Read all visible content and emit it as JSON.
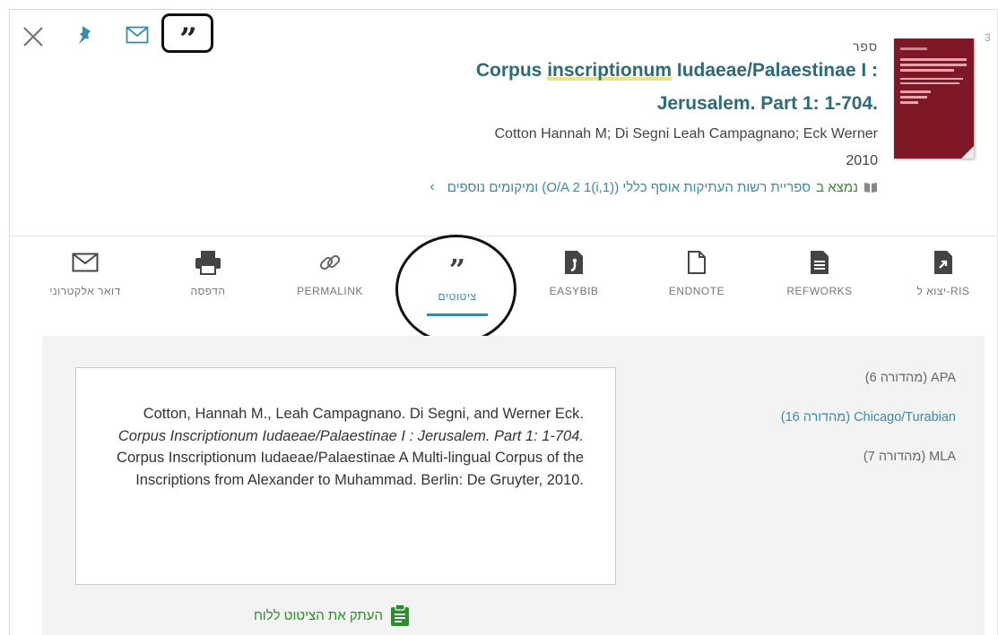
{
  "record": {
    "number": "3",
    "type": "ספר",
    "title_line1_pre": "Corpus ",
    "title_line1_hl": "inscriptionum",
    "title_line1_post": " Iudaeae/Palaestinae I :",
    "title_line2": "Jerusalem. Part 1: 1-704.",
    "authors": "Cotton Hannah M; Di Segni Leah Campagnano; Eck Werner",
    "year": "2010",
    "availability": {
      "found_label": "נמצא ב",
      "location": "ספריית רשות העתיקות אוסף כללי (O/A 2 1(i,1)) ומיקומים נוספים"
    }
  },
  "toolbar_icons": [
    "close-icon",
    "pin-icon",
    "email-icon",
    "quote-icon"
  ],
  "actions": [
    {
      "id": "email",
      "label": "דואר אלקטרוני",
      "icon": "envelope-icon"
    },
    {
      "id": "print",
      "label": "הדפסה",
      "icon": "printer-icon"
    },
    {
      "id": "permalink",
      "label": "PERMALINK",
      "icon": "link-icon"
    },
    {
      "id": "citation",
      "label": "ציטוטים",
      "icon": "quote-icon",
      "active": true
    },
    {
      "id": "easybib",
      "label": "EASYBIB",
      "icon": "easybib-icon"
    },
    {
      "id": "endnote",
      "label": "ENDNOTE",
      "icon": "document-icon"
    },
    {
      "id": "refworks",
      "label": "REFWORKS",
      "icon": "refworks-icon"
    },
    {
      "id": "ris",
      "label": "יצוא ל-RIS",
      "icon": "export-icon"
    }
  ],
  "citation_styles": [
    {
      "label": "APA (מהדורה 6)",
      "selected": false
    },
    {
      "label": "Chicago/Turabian (מהדורה 16)",
      "selected": true
    },
    {
      "label": "MLA (מהדורה 7)",
      "selected": false
    }
  ],
  "citation": {
    "part1": "Cotton, Hannah M., Leah Campagnano. Di Segni, and Werner Eck. ",
    "italic": "Corpus Inscriptionum Iudaeae/Palaestinae I : Jerusalem. Part 1: 1-704.",
    "part2": " Corpus Inscriptionum Iudaeae/Palaestinae A Multi-lingual Corpus of the Inscriptions from Alexander to Muhammad. Berlin: De Gruyter, 2010."
  },
  "copy_label": "העתק את הציטוט ללוח",
  "colors": {
    "accent": "#3a8ba8",
    "title": "#2e6a7a",
    "green": "#2e8b2e",
    "cover": "#7e1726"
  }
}
